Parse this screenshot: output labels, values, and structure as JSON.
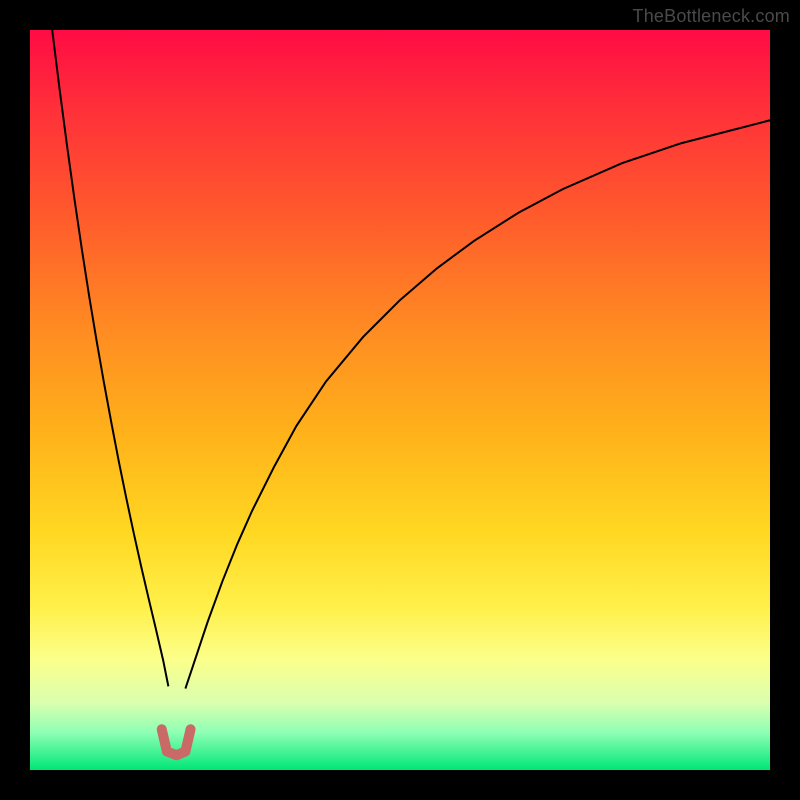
{
  "attribution": "TheBottleneck.com",
  "chart_data": {
    "type": "line",
    "title": "",
    "xlabel": "",
    "ylabel": "",
    "xlim": [
      0,
      100
    ],
    "ylim": [
      0,
      100
    ],
    "grid": false,
    "legend": false,
    "background_gradient": {
      "orientation": "vertical",
      "stops": [
        {
          "pos": 0.0,
          "color": "#ff0b44"
        },
        {
          "pos": 0.1,
          "color": "#ff2e3a"
        },
        {
          "pos": 0.25,
          "color": "#ff5a2c"
        },
        {
          "pos": 0.4,
          "color": "#ff8a22"
        },
        {
          "pos": 0.55,
          "color": "#ffb31a"
        },
        {
          "pos": 0.68,
          "color": "#ffd822"
        },
        {
          "pos": 0.78,
          "color": "#fff04a"
        },
        {
          "pos": 0.85,
          "color": "#fcff8a"
        },
        {
          "pos": 0.91,
          "color": "#d9ffb0"
        },
        {
          "pos": 0.95,
          "color": "#8cffb4"
        },
        {
          "pos": 1.0,
          "color": "#00e676"
        }
      ]
    },
    "series": [
      {
        "name": "curve-left",
        "color": "#000000",
        "width": 2,
        "x": [
          3.0,
          4.0,
          5.0,
          6.0,
          7.0,
          8.0,
          9.0,
          10.0,
          11.0,
          12.0,
          13.0,
          14.0,
          15.0,
          16.0,
          17.0,
          18.0,
          18.7
        ],
        "y": [
          100.0,
          92.0,
          84.4,
          77.2,
          70.4,
          64.0,
          58.0,
          52.3,
          46.9,
          41.7,
          36.8,
          32.1,
          27.6,
          23.3,
          19.1,
          14.8,
          11.3
        ]
      },
      {
        "name": "curve-right",
        "color": "#000000",
        "width": 2,
        "x": [
          21.0,
          22.0,
          24.0,
          26.0,
          28.0,
          30.0,
          33.0,
          36.0,
          40.0,
          45.0,
          50.0,
          55.0,
          60.0,
          66.0,
          72.0,
          80.0,
          88.0,
          95.0,
          100.0
        ],
        "y": [
          11.0,
          14.0,
          20.0,
          25.5,
          30.5,
          35.0,
          41.0,
          46.5,
          52.5,
          58.5,
          63.5,
          67.8,
          71.5,
          75.3,
          78.5,
          82.0,
          84.7,
          86.5,
          87.8
        ]
      },
      {
        "name": "valley-marker",
        "type": "marker-path",
        "color": "#c96a66",
        "width": 10,
        "linecap": "round",
        "x": [
          17.8,
          18.5,
          19.8,
          21.0,
          21.7
        ],
        "y": [
          5.5,
          2.5,
          2.0,
          2.5,
          5.5
        ]
      }
    ]
  }
}
